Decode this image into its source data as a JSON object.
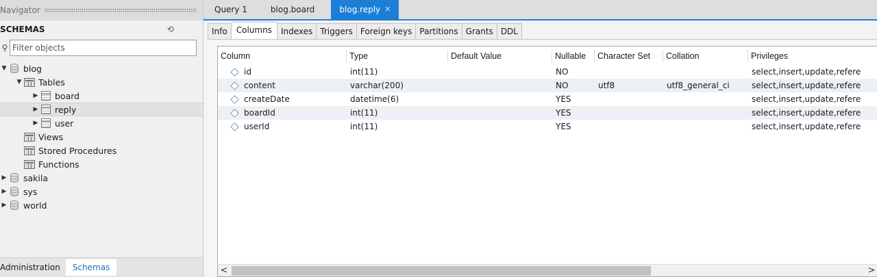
{
  "navigator": {
    "title": "Navigator",
    "schemas_label": "SCHEMAS",
    "filter_placeholder": "Filter objects",
    "tree": {
      "blog": "blog",
      "tables": "Tables",
      "board": "board",
      "reply": "reply",
      "user": "user",
      "views": "Views",
      "stored_procedures": "Stored Procedures",
      "functions": "Functions",
      "sakila": "sakila",
      "sys": "sys",
      "world": "world"
    },
    "bottom_tabs": [
      "Administration",
      "Schemas"
    ]
  },
  "doc_tabs": [
    "Query 1",
    "blog.board",
    "blog.reply"
  ],
  "sub_tabs": [
    "Info",
    "Columns",
    "Indexes",
    "Triggers",
    "Foreign keys",
    "Partitions",
    "Grants",
    "DDL"
  ],
  "grid": {
    "headers": [
      "Column",
      "Type",
      "Default Value",
      "Nullable",
      "Character Set",
      "Collation",
      "Privileges"
    ],
    "rows": [
      {
        "name": "id",
        "type": "int(11)",
        "default": "",
        "nullable": "NO",
        "charset": "",
        "collation": "",
        "privileges": "select,insert,update,refere"
      },
      {
        "name": "content",
        "type": "varchar(200)",
        "default": "",
        "nullable": "NO",
        "charset": "utf8",
        "collation": "utf8_general_ci",
        "privileges": "select,insert,update,refere"
      },
      {
        "name": "createDate",
        "type": "datetime(6)",
        "default": "",
        "nullable": "YES",
        "charset": "",
        "collation": "",
        "privileges": "select,insert,update,refere"
      },
      {
        "name": "boardId",
        "type": "int(11)",
        "default": "",
        "nullable": "YES",
        "charset": "",
        "collation": "",
        "privileges": "select,insert,update,refere"
      },
      {
        "name": "userId",
        "type": "int(11)",
        "default": "",
        "nullable": "YES",
        "charset": "",
        "collation": "",
        "privileges": "select,insert,update,refere"
      }
    ]
  },
  "icons": {
    "refresh": "refresh-icon",
    "search": "search-icon",
    "close": "close-icon",
    "scroll_left": "<",
    "scroll_right": ">"
  },
  "colors": {
    "accent": "#1c7fd6",
    "schemas_tab": "#1c6fb8"
  }
}
